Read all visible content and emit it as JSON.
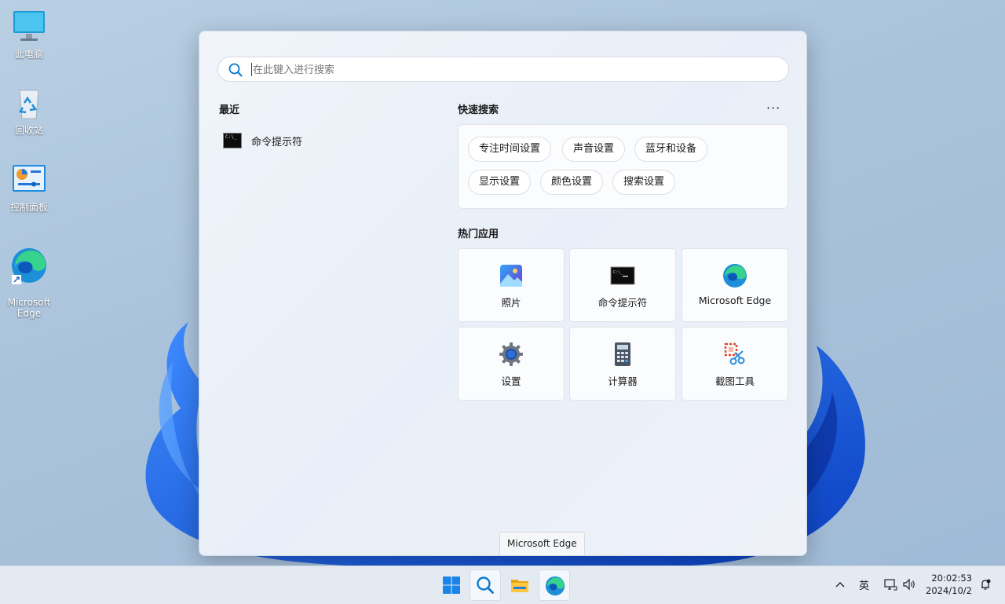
{
  "desktop": {
    "icons": [
      {
        "label": "此电脑",
        "icon": "computer-icon"
      },
      {
        "label": "回收站",
        "icon": "recycle-bin-icon"
      },
      {
        "label": "控制面板",
        "icon": "control-panel-icon"
      },
      {
        "label": "Microsoft\nEdge",
        "icon": "edge-icon"
      }
    ]
  },
  "search": {
    "placeholder": "在此键入进行搜索"
  },
  "recent": {
    "title": "最近",
    "items": [
      {
        "label": "命令提示符",
        "icon": "cmd-icon"
      }
    ]
  },
  "quick_search": {
    "title": "快速搜索",
    "more_label": "···",
    "chips": [
      "专注时间设置",
      "声音设置",
      "蓝牙和设备",
      "显示设置",
      "颜色设置",
      "搜索设置"
    ]
  },
  "top_apps": {
    "title": "热门应用",
    "apps": [
      {
        "label": "照片",
        "icon": "photos-icon"
      },
      {
        "label": "命令提示符",
        "icon": "cmd-icon"
      },
      {
        "label": "Microsoft Edge",
        "icon": "edge-icon"
      },
      {
        "label": "设置",
        "icon": "settings-gear-icon"
      },
      {
        "label": "计算器",
        "icon": "calculator-icon"
      },
      {
        "label": "截图工具",
        "icon": "snipping-tool-icon"
      }
    ]
  },
  "tooltip": "Microsoft Edge",
  "taskbar": {
    "ime_label": "英",
    "time": "20:02:53",
    "date": "2024/10/2"
  },
  "colors": {
    "accent": "#0067c0",
    "bloom": "#1a5fe0"
  }
}
